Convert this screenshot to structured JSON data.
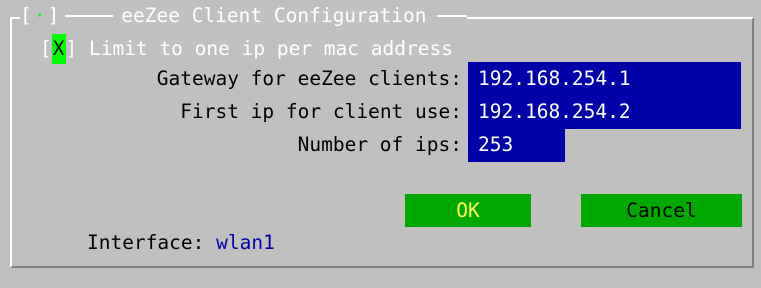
{
  "dialog": {
    "title": "eeZee Client Configuration",
    "close_glyph": "·"
  },
  "checkbox": {
    "mark": "X",
    "label": "Limit to one ip per mac address"
  },
  "fields": {
    "gateway_label": "Gateway for eeZee clients:",
    "gateway_value": "192.168.254.1",
    "first_ip_label": "First ip for client use:",
    "first_ip_value": "192.168.254.2",
    "num_ips_label": "Number of ips:",
    "num_ips_value": "253"
  },
  "interface": {
    "label": "Interface:",
    "value": "wlan1"
  },
  "buttons": {
    "ok_label": "OK",
    "cancel_label": "Cancel"
  },
  "colors": {
    "background": "#c0c0c0",
    "field_bg": "#0000a8",
    "button_bg": "#00a800",
    "highlight": "#00ff00",
    "ok_text": "#ffff54"
  }
}
